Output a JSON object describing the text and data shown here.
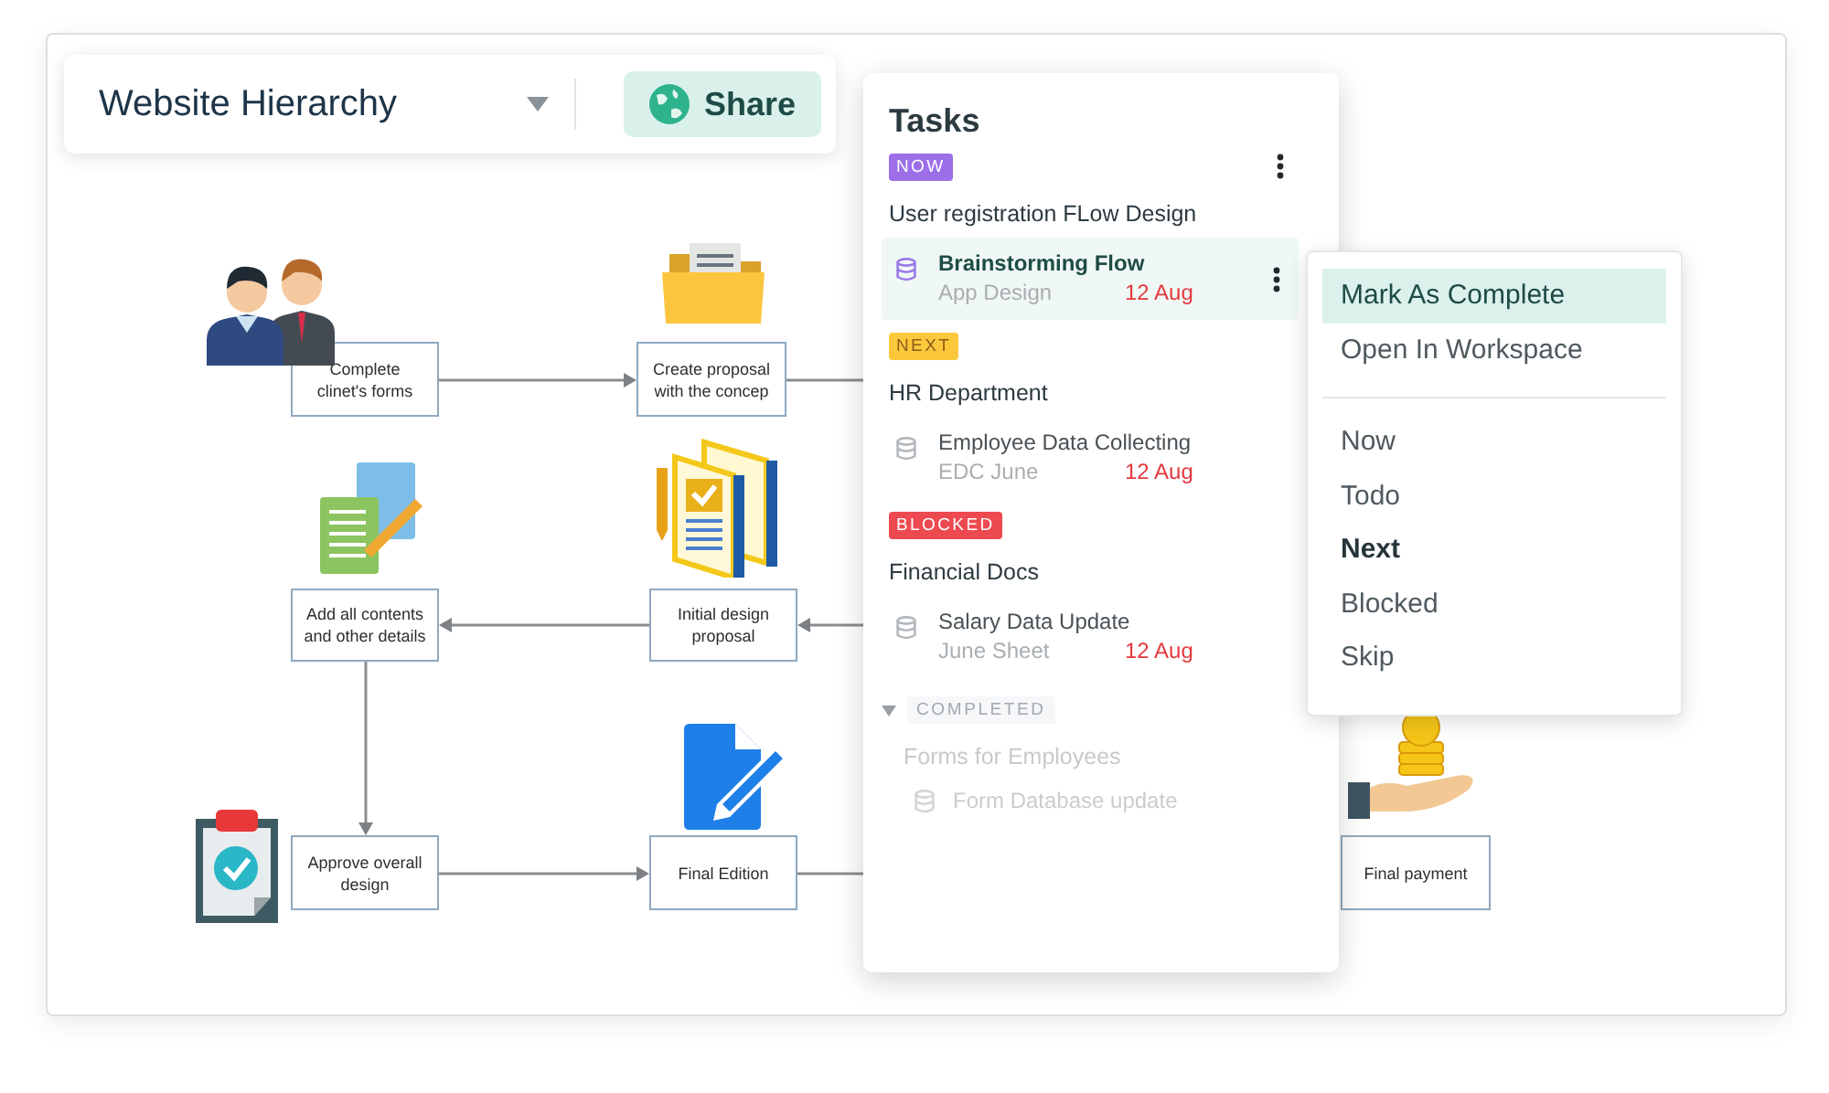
{
  "header": {
    "title": "Website Hierarchy",
    "share_label": "Share"
  },
  "diagram": {
    "nodes": [
      {
        "label": "Complete clinet's forms"
      },
      {
        "label": "Create proposal with the concep"
      },
      {
        "label": "Add all contents and other details"
      },
      {
        "label": "Initial design proposal"
      },
      {
        "label": "Approve overall design"
      },
      {
        "label": "Final Edition"
      },
      {
        "label": "Final  payment"
      }
    ]
  },
  "tasks": {
    "title": "Tasks",
    "groups": [
      {
        "tag": "NOW",
        "kind": "now",
        "menu": true,
        "title": "User registration FLow Design",
        "items": [
          {
            "name": "Brainstorming Flow",
            "project": "App Design",
            "due": "12 Aug",
            "selected": true
          }
        ]
      },
      {
        "tag": "NEXT",
        "kind": "next",
        "menu": false,
        "title": "HR Department",
        "items": [
          {
            "name": "Employee Data Collecting",
            "project": "EDC June",
            "due": "12 Aug",
            "selected": false
          }
        ]
      },
      {
        "tag": "BLOCKED",
        "kind": "blocked",
        "menu": false,
        "title": "Financial Docs",
        "items": [
          {
            "name": "Salary Data Update",
            "project": "June Sheet",
            "due": "12 Aug",
            "selected": false
          }
        ]
      }
    ],
    "completed": {
      "label": "COMPLETED",
      "expanded": true,
      "title": "Forms for Employees",
      "items": [
        {
          "name": "Form Database update"
        }
      ]
    }
  },
  "menu": {
    "sections": [
      [
        {
          "label": "Mark As Complete",
          "selected": true,
          "current": false
        },
        {
          "label": "Open In Workspace",
          "selected": false,
          "current": false
        }
      ],
      [
        {
          "label": "Now",
          "selected": false,
          "current": false
        },
        {
          "label": "Todo",
          "selected": false,
          "current": false
        },
        {
          "label": "Next",
          "selected": false,
          "current": true
        },
        {
          "label": "Blocked",
          "selected": false,
          "current": false
        },
        {
          "label": "Skip",
          "selected": false,
          "current": false
        }
      ]
    ]
  }
}
